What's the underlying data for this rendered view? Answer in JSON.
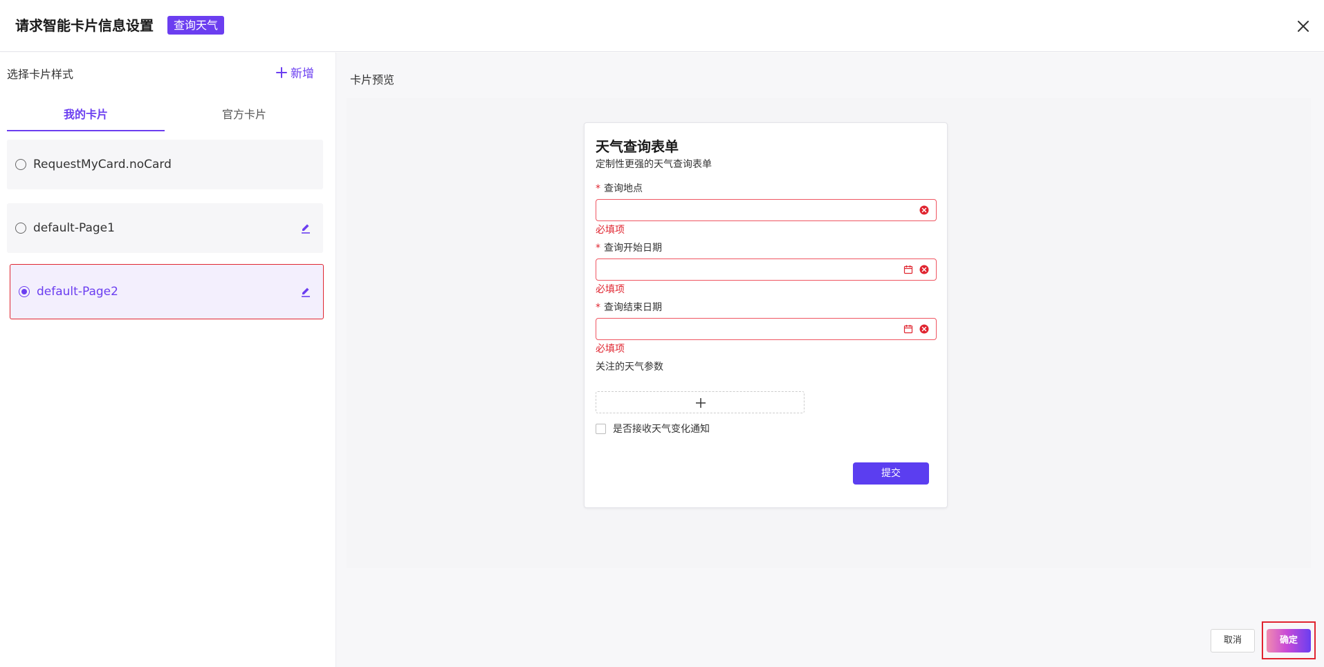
{
  "header": {
    "title": "请求智能卡片信息设置",
    "tag": "查询天气"
  },
  "left": {
    "section_label": "选择卡片样式",
    "add_label": "新增",
    "tabs": [
      {
        "label": "我的卡片",
        "active": true
      },
      {
        "label": "官方卡片",
        "active": false
      }
    ],
    "cards": [
      {
        "name": "RequestMyCard.noCard",
        "selected": false,
        "editable": false
      },
      {
        "name": "default-Page1",
        "selected": false,
        "editable": true
      },
      {
        "name": "default-Page2",
        "selected": true,
        "editable": true
      }
    ]
  },
  "preview": {
    "label": "卡片预览",
    "form": {
      "title": "天气查询表单",
      "subtitle": "定制性更强的天气查询表单",
      "fields": [
        {
          "label": "查询地点",
          "required": true,
          "error": "必填项",
          "type": "text"
        },
        {
          "label": "查询开始日期",
          "required": true,
          "error": "必填项",
          "type": "date"
        },
        {
          "label": "查询结束日期",
          "required": true,
          "error": "必填项",
          "type": "date"
        }
      ],
      "params_label": "关注的天气参数",
      "checkbox_label": "是否接收天气变化通知",
      "submit_label": "提交"
    }
  },
  "footer": {
    "cancel_label": "取消",
    "ok_label": "确定"
  },
  "colors": {
    "accent": "#6b3ef0",
    "error": "#e0242f"
  }
}
